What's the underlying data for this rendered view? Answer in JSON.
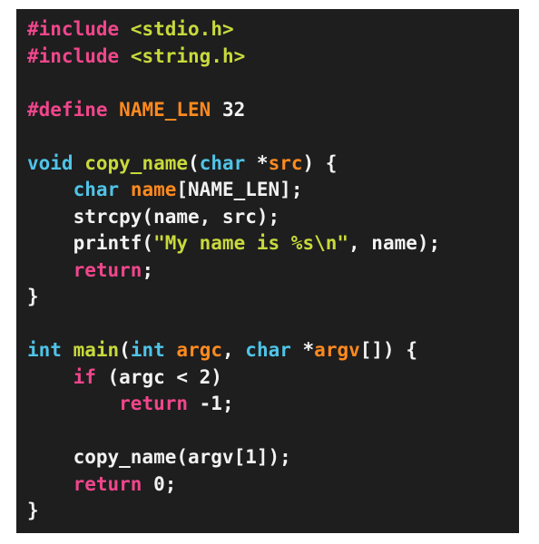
{
  "editor": {
    "lines": [
      [
        {
          "t": "#include",
          "c": "pink"
        },
        {
          "t": " ",
          "c": "white"
        },
        {
          "t": "<stdio.h>",
          "c": "ygreen"
        }
      ],
      [
        {
          "t": "#include",
          "c": "pink"
        },
        {
          "t": " ",
          "c": "white"
        },
        {
          "t": "<string.h>",
          "c": "ygreen"
        }
      ],
      [],
      [
        {
          "t": "#define",
          "c": "pink"
        },
        {
          "t": " ",
          "c": "white"
        },
        {
          "t": "NAME_LEN",
          "c": "orange"
        },
        {
          "t": " 32",
          "c": "white"
        }
      ],
      [],
      [
        {
          "t": "void",
          "c": "cyan"
        },
        {
          "t": " ",
          "c": "white"
        },
        {
          "t": "copy_name",
          "c": "ygreen"
        },
        {
          "t": "(",
          "c": "white"
        },
        {
          "t": "char",
          "c": "cyan"
        },
        {
          "t": " *",
          "c": "white"
        },
        {
          "t": "src",
          "c": "orange"
        },
        {
          "t": ") {",
          "c": "white"
        }
      ],
      [
        {
          "t": "    ",
          "c": "white"
        },
        {
          "t": "char",
          "c": "cyan"
        },
        {
          "t": " ",
          "c": "white"
        },
        {
          "t": "name",
          "c": "orange"
        },
        {
          "t": "[NAME_LEN];",
          "c": "white"
        }
      ],
      [
        {
          "t": "    strcpy(name, src);",
          "c": "white"
        }
      ],
      [
        {
          "t": "    printf(",
          "c": "white"
        },
        {
          "t": "\"My name is %s\\n\"",
          "c": "ygreen"
        },
        {
          "t": ", name);",
          "c": "white"
        }
      ],
      [
        {
          "t": "    ",
          "c": "white"
        },
        {
          "t": "return",
          "c": "pink"
        },
        {
          "t": ";",
          "c": "white"
        }
      ],
      [
        {
          "t": "}",
          "c": "white"
        }
      ],
      [],
      [
        {
          "t": "int",
          "c": "cyan"
        },
        {
          "t": " ",
          "c": "white"
        },
        {
          "t": "main",
          "c": "ygreen"
        },
        {
          "t": "(",
          "c": "white"
        },
        {
          "t": "int",
          "c": "cyan"
        },
        {
          "t": " ",
          "c": "white"
        },
        {
          "t": "argc",
          "c": "orange"
        },
        {
          "t": ", ",
          "c": "white"
        },
        {
          "t": "char",
          "c": "cyan"
        },
        {
          "t": " *",
          "c": "white"
        },
        {
          "t": "argv",
          "c": "orange"
        },
        {
          "t": "[]) {",
          "c": "white"
        }
      ],
      [
        {
          "t": "    ",
          "c": "white"
        },
        {
          "t": "if",
          "c": "pink"
        },
        {
          "t": " (argc < 2)",
          "c": "white"
        }
      ],
      [
        {
          "t": "        ",
          "c": "white"
        },
        {
          "t": "return",
          "c": "pink"
        },
        {
          "t": " -1;",
          "c": "white"
        }
      ],
      [],
      [
        {
          "t": "    copy_name(argv[1]);",
          "c": "white"
        }
      ],
      [
        {
          "t": "    ",
          "c": "white"
        },
        {
          "t": "return",
          "c": "pink"
        },
        {
          "t": " 0;",
          "c": "white"
        }
      ],
      [
        {
          "t": "}",
          "c": "white"
        }
      ]
    ]
  }
}
